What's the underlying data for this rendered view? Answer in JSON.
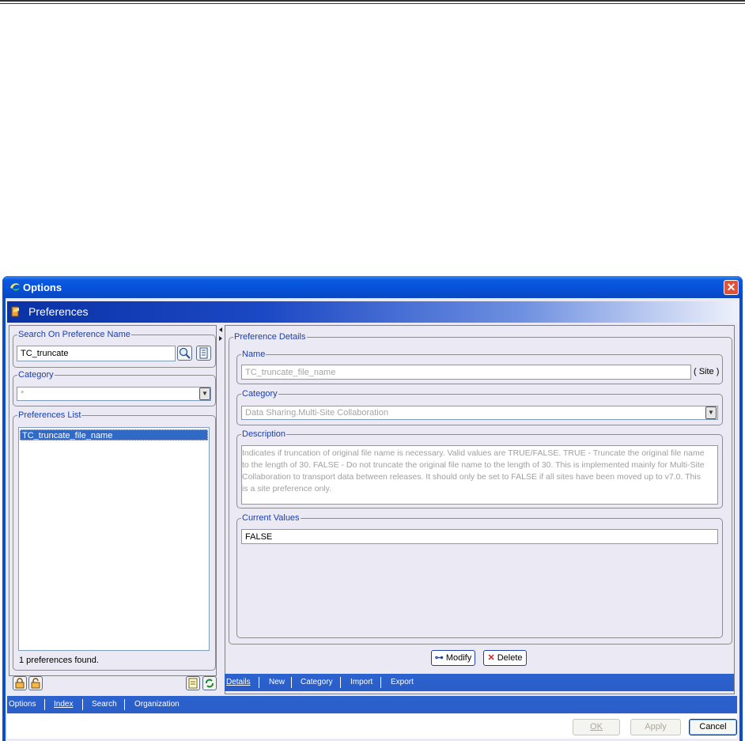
{
  "window": {
    "title": "Options",
    "header": "Preferences"
  },
  "left": {
    "search_legend": "Search On Preference Name",
    "search_value": "TC_truncate",
    "category_legend": "Category",
    "category_value": "*",
    "list_legend": "Preferences List",
    "list_items": [
      "TC_truncate_file_name"
    ],
    "status": "1 preferences found."
  },
  "details": {
    "legend": "Preference Details",
    "name_legend": "Name",
    "name_value": "TC_truncate_file_name",
    "scope": "( Site )",
    "category_legend": "Category",
    "category_value": "Data Sharing.Multi-Site Collaboration",
    "description_legend": "Description",
    "description_lines": [
      "Indicates if truncation of original file name is necessary. Valid values are TRUE/FALSE. TRUE - Truncate the original file name",
      "to the length of 30. FALSE - Do not truncate the original file name to the length of 30. This is implemented mainly for Multi-Site",
      "Collaboration to transport data between releases. It should only be set to FALSE if all sites have been moved up to v7.0. This",
      "is a site preference only."
    ],
    "values_legend": "Current Values",
    "current_value": "FALSE",
    "modify_label": "Modify",
    "delete_label": "Delete"
  },
  "details_tabs": [
    "Details",
    "New",
    "Category",
    "Import",
    "Export"
  ],
  "bottom_tabs": [
    "Options",
    "Index",
    "Search",
    "Organization"
  ],
  "footer": {
    "ok": "OK",
    "apply": "Apply",
    "cancel": "Cancel"
  },
  "colors": {
    "titlebar": "#0a5ae0",
    "selection": "#3169c6",
    "legend_text": "#1b3fa8",
    "delete_icon": "#d02020"
  }
}
